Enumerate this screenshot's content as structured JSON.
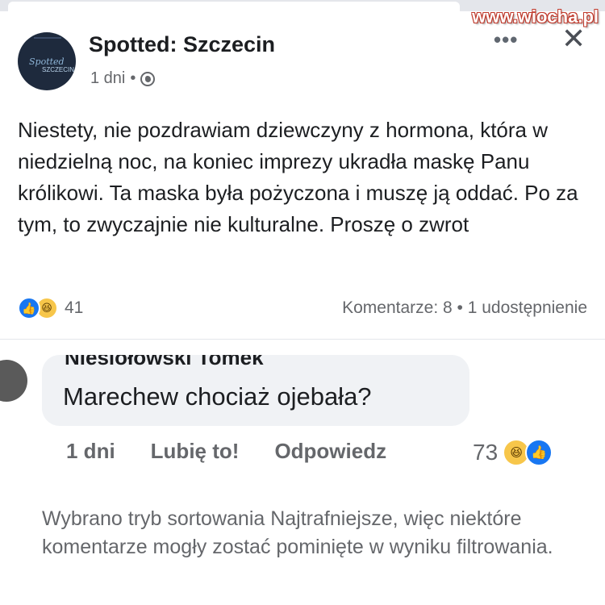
{
  "watermark": "www.wiocha.pl",
  "post": {
    "page_name": "Spotted: Szczecin",
    "time": "1 dni",
    "separator": "•",
    "avatar_text": "Spotted",
    "avatar_subtext": "SZCZECIN",
    "text": "Niestety, nie pozdrawiam dziewczyny z hormona, która w niedzielną noc, na koniec imprezy ukradła maskę Panu królikowi. Ta maska była pożyczona i muszę ją oddać. Po za tym, to zwyczajnie nie kulturalne. Proszę o zwrot",
    "reaction_count": "41",
    "comments_shares": "Komentarze: 8 • 1 udostępnienie"
  },
  "comment": {
    "author": "Niesiołowski Tomek",
    "text": "Marechew chociaż ojebała?",
    "time": "1 dni",
    "like_label": "Lubię to!",
    "reply_label": "Odpowiedz",
    "reaction_count": "73"
  },
  "filter_note": "Wybrano tryb sortowania Najtrafniejsze, więc niektóre komentarze mogły zostać pominięte w wyniku filtrowania.",
  "icons": {
    "more": "more-horizontal-icon",
    "close": "close-icon",
    "globe": "globe-icon",
    "like": "like-reaction-icon",
    "haha": "haha-reaction-icon"
  },
  "colors": {
    "brand_blue": "#1877f2",
    "haha_yellow": "#f7c64a",
    "secondary_text": "#65676b",
    "bubble_bg": "#f0f2f5"
  }
}
